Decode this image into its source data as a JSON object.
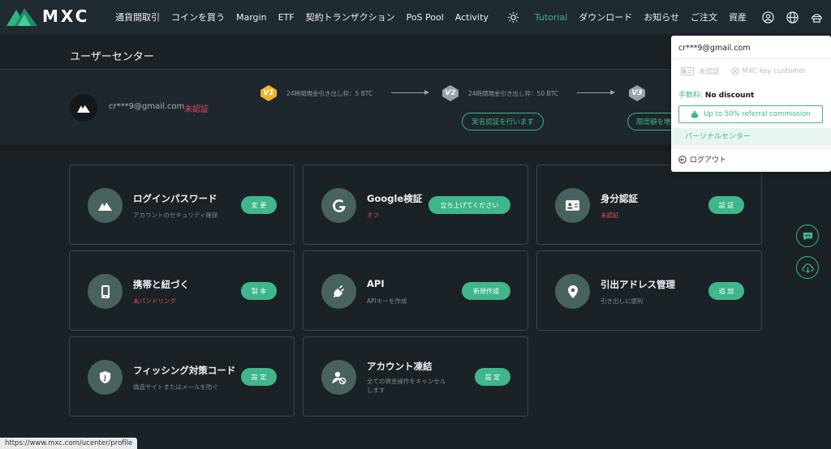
{
  "brand": {
    "name": "MXC"
  },
  "nav": {
    "items": [
      "通貨間取引",
      "コインを買う",
      "Margin",
      "ETF",
      "契約トランザクション",
      "PoS Pool",
      "Activity"
    ],
    "right_items": [
      "Tutorial",
      "ダウンロード",
      "お知らせ",
      "ご注文",
      "資産"
    ],
    "icons": [
      "sun-icon",
      "user-icon",
      "globe-icon",
      "service-icon"
    ]
  },
  "user_center": {
    "title": "ユーザーセンター",
    "email": "cr***9@gmail.com",
    "status": "未認証",
    "levels": [
      {
        "badge": "V1",
        "text": "24時間現金引き出し枠：5 BTC"
      },
      {
        "badge": "V2",
        "text": "24時間現金引き出し枠：50 BTC",
        "button": "実名認証を行います"
      },
      {
        "badge": "V3",
        "button": "限度額を増"
      }
    ]
  },
  "cards": [
    {
      "title": "ログインパスワード",
      "sub": "アカウントのセキュリティ確保",
      "button": "変 更",
      "icon": "logo-icon"
    },
    {
      "title": "Google検証",
      "sub": "オフ",
      "button": "立ち上げてください",
      "icon": "google-icon"
    },
    {
      "title": "身分認証",
      "sub": "未認証",
      "button": "認 証",
      "icon": "id-card-icon"
    },
    {
      "title": "携帯と紐づく",
      "sub": "未バンドリング",
      "button": "製 本",
      "icon": "phone-icon"
    },
    {
      "title": "API",
      "sub": "APIキーを作成",
      "button": "新規作成",
      "icon": "plug-icon"
    },
    {
      "title": "引出アドレス管理",
      "sub": "引き出しに便利",
      "button": "追 加",
      "icon": "location-icon"
    },
    {
      "title": "フィッシング対策コード",
      "sub": "偽造サイトまたはメールを防ぐ",
      "button": "設 定",
      "icon": "shield-icon"
    },
    {
      "title": "アカウント凍結",
      "sub": "全ての資金操作をキャンセルします",
      "button": "設 定",
      "icon": "user-block-icon"
    }
  ],
  "dropdown": {
    "email": "cr***9@gmail.com",
    "verify_label": "未認証",
    "mxc_key_label": "MXC key customer",
    "fee_label": "手数料:",
    "fee_value": "No discount",
    "referral": "Up to 50% referral commission",
    "personal_center": "パーソナルセンター",
    "logout": "ログアウト"
  },
  "status_bar": {
    "url": "https://www.mxc.com/ucenter/profile"
  },
  "colors": {
    "accent": "#3fb68b",
    "danger": "#e34d56",
    "background": "#1b2227",
    "nav": "#1f2a31"
  }
}
